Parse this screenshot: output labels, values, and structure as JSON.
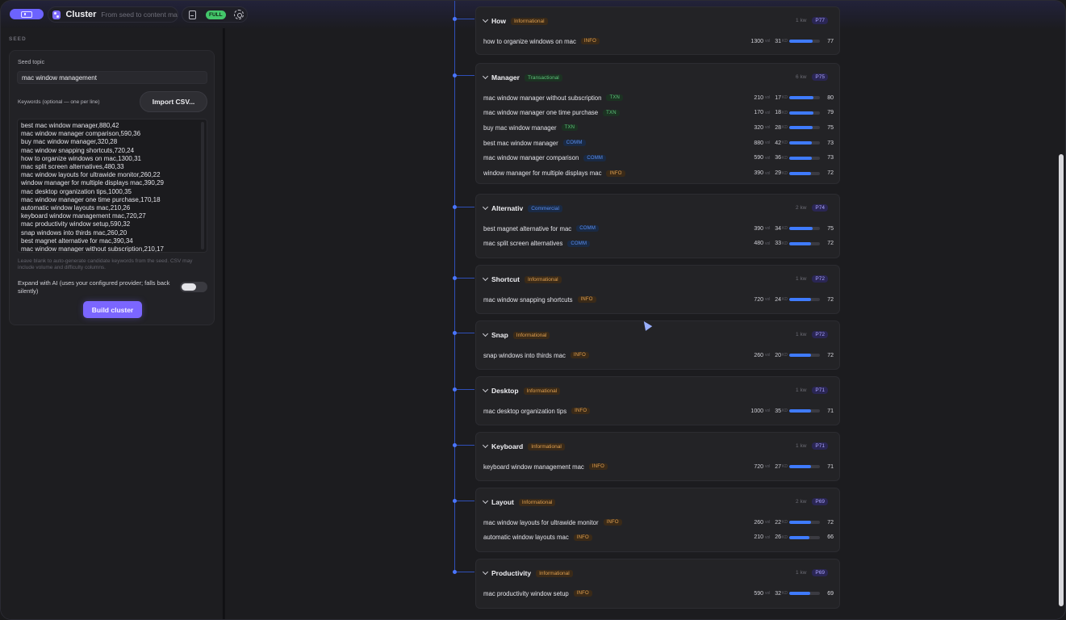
{
  "header": {
    "app_title": "Cluster",
    "app_subtitle": "From seed to content map",
    "mode_badge": "FULL"
  },
  "sidebar": {
    "section_label": "SEED",
    "seed_topic_label": "Seed topic",
    "seed_topic_value": "mac window management",
    "keywords_label": "Keywords (optional — one per line)",
    "import_button": "Import CSV...",
    "keywords_lines": [
      "best mac window manager,880,42",
      "mac window manager comparison,590,36",
      "buy mac window manager,320,28",
      "mac window snapping shortcuts,720,24",
      "how to organize windows on mac,1300,31",
      "mac split screen alternatives,480,33",
      "mac window layouts for ultrawide monitor,260,22",
      "window manager for multiple displays mac,390,29",
      "mac desktop organization tips,1000,35",
      "mac window manager one time purchase,170,18",
      "automatic window layouts mac,210,26",
      "keyboard window management mac,720,27",
      "mac productivity window setup,590,32",
      "snap windows into thirds mac,260,20",
      "best magnet alternative for mac,390,34",
      "mac window manager without subscription,210,17"
    ],
    "hint": "Leave blank to auto-generate candidate keywords from the seed. CSV may include volume and difficulty columns.",
    "expand_label": "Expand with AI (uses your configured provider; falls back silently)",
    "build_button": "Build cluster"
  },
  "units": {
    "vol": "vol",
    "kd": "KD"
  },
  "clusters": [
    {
      "title": "How",
      "intent": "Informational",
      "intent_class": "info",
      "count": "1 kw",
      "priority": "P77",
      "keywords": [
        {
          "name": "how to organize windows on mac",
          "tag": "INFO",
          "tag_class": "info",
          "vol": "1300",
          "kd": "31",
          "score": "77"
        }
      ]
    },
    {
      "title": "Manager",
      "intent": "Transactional",
      "intent_class": "txn",
      "count": "6 kw",
      "priority": "P75",
      "keywords": [
        {
          "name": "mac window manager without subscription",
          "tag": "TXN",
          "tag_class": "txn",
          "vol": "210",
          "kd": "17",
          "score": "80"
        },
        {
          "name": "mac window manager one time purchase",
          "tag": "TXN",
          "tag_class": "txn",
          "vol": "170",
          "kd": "18",
          "score": "79"
        },
        {
          "name": "buy mac window manager",
          "tag": "TXN",
          "tag_class": "txn",
          "vol": "320",
          "kd": "28",
          "score": "75"
        },
        {
          "name": "best mac window manager",
          "tag": "COMM",
          "tag_class": "comm",
          "vol": "880",
          "kd": "42",
          "score": "73"
        },
        {
          "name": "mac window manager comparison",
          "tag": "COMM",
          "tag_class": "comm",
          "vol": "590",
          "kd": "36",
          "score": "73"
        },
        {
          "name": "window manager for multiple displays mac",
          "tag": "INFO",
          "tag_class": "info",
          "vol": "390",
          "kd": "29",
          "score": "72"
        }
      ]
    },
    {
      "title": "Alternativ",
      "intent": "Commercial",
      "intent_class": "comm",
      "count": "2 kw",
      "priority": "P74",
      "keywords": [
        {
          "name": "best magnet alternative for mac",
          "tag": "COMM",
          "tag_class": "comm",
          "vol": "390",
          "kd": "34",
          "score": "75"
        },
        {
          "name": "mac split screen alternatives",
          "tag": "COMM",
          "tag_class": "comm",
          "vol": "480",
          "kd": "33",
          "score": "72"
        }
      ]
    },
    {
      "title": "Shortcut",
      "intent": "Informational",
      "intent_class": "info",
      "count": "1 kw",
      "priority": "P72",
      "keywords": [
        {
          "name": "mac window snapping shortcuts",
          "tag": "INFO",
          "tag_class": "info",
          "vol": "720",
          "kd": "24",
          "score": "72"
        }
      ]
    },
    {
      "title": "Snap",
      "intent": "Informational",
      "intent_class": "info",
      "count": "1 kw",
      "priority": "P72",
      "keywords": [
        {
          "name": "snap windows into thirds mac",
          "tag": "INFO",
          "tag_class": "info",
          "vol": "260",
          "kd": "20",
          "score": "72"
        }
      ]
    },
    {
      "title": "Desktop",
      "intent": "Informational",
      "intent_class": "info",
      "count": "1 kw",
      "priority": "P71",
      "keywords": [
        {
          "name": "mac desktop organization tips",
          "tag": "INFO",
          "tag_class": "info",
          "vol": "1000",
          "kd": "35",
          "score": "71"
        }
      ]
    },
    {
      "title": "Keyboard",
      "intent": "Informational",
      "intent_class": "info",
      "count": "1 kw",
      "priority": "P71",
      "keywords": [
        {
          "name": "keyboard window management mac",
          "tag": "INFO",
          "tag_class": "info",
          "vol": "720",
          "kd": "27",
          "score": "71"
        }
      ]
    },
    {
      "title": "Layout",
      "intent": "Informational",
      "intent_class": "info",
      "count": "2 kw",
      "priority": "P69",
      "keywords": [
        {
          "name": "mac window layouts for ultrawide monitor",
          "tag": "INFO",
          "tag_class": "info",
          "vol": "260",
          "kd": "22",
          "score": "72"
        },
        {
          "name": "automatic window layouts mac",
          "tag": "INFO",
          "tag_class": "info",
          "vol": "210",
          "kd": "26",
          "score": "66"
        }
      ]
    },
    {
      "title": "Productivity",
      "intent": "Informational",
      "intent_class": "info",
      "count": "1 kw",
      "priority": "P69",
      "keywords": [
        {
          "name": "mac productivity window setup",
          "tag": "INFO",
          "tag_class": "info",
          "vol": "590",
          "kd": "32",
          "score": "69"
        }
      ]
    }
  ]
}
